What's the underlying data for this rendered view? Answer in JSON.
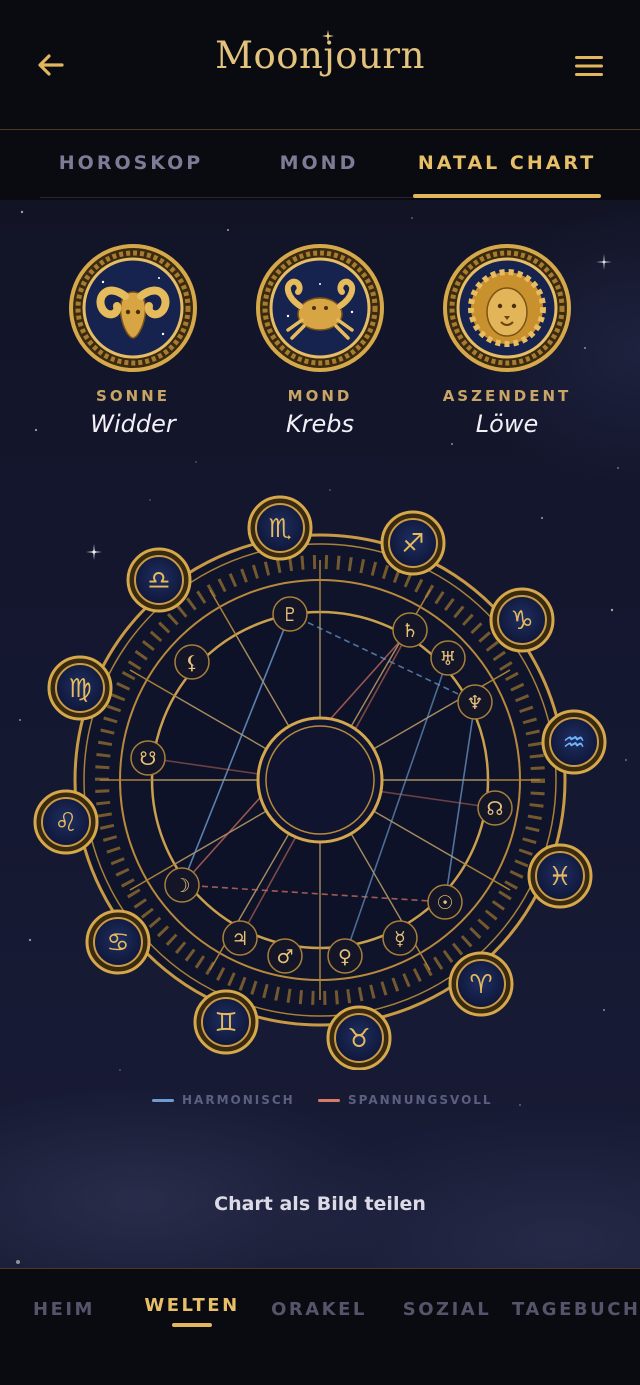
{
  "app": {
    "title": "Moonjourn"
  },
  "header": {
    "back_icon": "arrow-left-icon",
    "menu_icon": "hamburger-menu-icon"
  },
  "tabs": [
    {
      "label": "HOROSKOP",
      "active": false
    },
    {
      "label": "MOND",
      "active": false
    },
    {
      "label": "NATAL CHART",
      "active": true
    }
  ],
  "big_three": [
    {
      "caption": "SONNE",
      "value": "Widder",
      "icon": "aries-ram-medallion-icon"
    },
    {
      "caption": "MOND",
      "value": "Krebs",
      "icon": "cancer-crab-medallion-icon"
    },
    {
      "caption": "ASZENDENT",
      "value": "Löwe",
      "icon": "leo-lion-medallion-icon"
    }
  ],
  "wheel": {
    "zodiac_medallions": [
      "scorpio-icon",
      "sagittarius-icon",
      "capricorn-icon",
      "aquarius-icon",
      "pisces-icon",
      "aries-icon",
      "taurus-icon",
      "gemini-icon",
      "cancer-icon",
      "leo-icon",
      "virgo-icon",
      "libra-icon"
    ],
    "planet_glyphs": [
      {
        "name": "pluto",
        "glyph": "♇"
      },
      {
        "name": "saturn",
        "glyph": "♄"
      },
      {
        "name": "uranus",
        "glyph": "♅"
      },
      {
        "name": "neptune",
        "glyph": "♆"
      },
      {
        "name": "north-node",
        "glyph": "☊"
      },
      {
        "name": "sun",
        "glyph": "☉"
      },
      {
        "name": "mercury",
        "glyph": "☿"
      },
      {
        "name": "venus",
        "glyph": "♀"
      },
      {
        "name": "mars",
        "glyph": "♂"
      },
      {
        "name": "jupiter",
        "glyph": "♃"
      },
      {
        "name": "moon",
        "glyph": "☽"
      },
      {
        "name": "south-node",
        "glyph": "☋"
      },
      {
        "name": "lilith",
        "glyph": "⚸"
      }
    ],
    "aspect_colors": {
      "harmonic": "#6f9ccf",
      "tension": "#c86e5e"
    }
  },
  "legend": [
    {
      "label": "HARMONISCH",
      "color": "#6f9ccf"
    },
    {
      "label": "SPANNUNGSVOLL",
      "color": "#d77a66"
    }
  ],
  "share": {
    "label": "Chart als Bild teilen"
  },
  "bottom_nav": [
    {
      "label": "HEIM",
      "active": false
    },
    {
      "label": "WELTEN",
      "active": true
    },
    {
      "label": "ORAKEL",
      "active": false
    },
    {
      "label": "SOZIAL",
      "active": false
    },
    {
      "label": "TAGEBUCH",
      "active": false
    }
  ]
}
